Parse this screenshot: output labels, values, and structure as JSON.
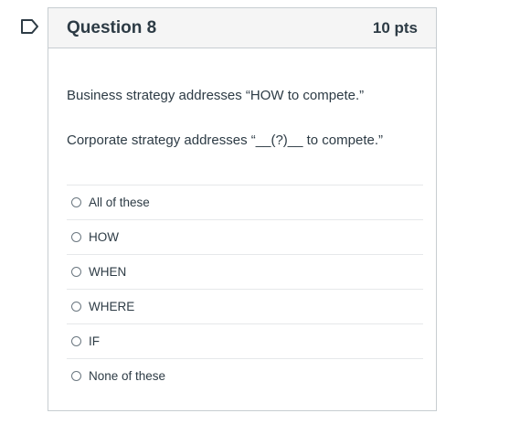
{
  "question": {
    "title": "Question 8",
    "points": "10 pts",
    "line1": "Business strategy addresses “HOW to compete.”",
    "line2": "Corporate strategy addresses “__(?)__ to compete.”"
  },
  "icons": {
    "flag": "flag-icon"
  },
  "answers": [
    {
      "label": "All of these"
    },
    {
      "label": "HOW"
    },
    {
      "label": "WHEN"
    },
    {
      "label": "WHERE"
    },
    {
      "label": "IF"
    },
    {
      "label": "None of these"
    }
  ]
}
